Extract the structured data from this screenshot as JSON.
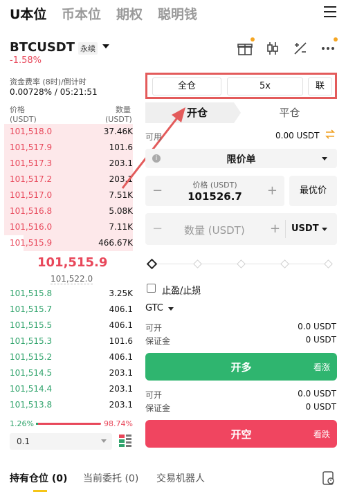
{
  "topnav": {
    "tabs": [
      "U本位",
      "币本位",
      "期权",
      "聪明钱"
    ],
    "active_index": 0
  },
  "pair": {
    "symbol": "BTCUSDT",
    "tag": "永续",
    "change": "-1.58%"
  },
  "icons": {
    "gift": "gift-icon",
    "candles": "candlestick-icon",
    "calc": "calculator-icon",
    "more": "more-icon"
  },
  "funding": {
    "label": "资金费率 (8时)/倒计时",
    "value": "0.00728% / 05:21:51"
  },
  "orderbook": {
    "price_header": "价格",
    "price_unit": "(USDT)",
    "qty_header": "数量",
    "qty_unit": "(USDT)",
    "asks": [
      {
        "price": "101,518.0",
        "qty": "37.46K",
        "depth": 1.0
      },
      {
        "price": "101,517.9",
        "qty": "101.6",
        "depth": 1.0
      },
      {
        "price": "101,517.3",
        "qty": "203.1",
        "depth": 1.0
      },
      {
        "price": "101,517.2",
        "qty": "203.1",
        "depth": 1.0
      },
      {
        "price": "101,517.0",
        "qty": "7.51K",
        "depth": 1.0
      },
      {
        "price": "101,516.8",
        "qty": "5.08K",
        "depth": 1.0
      },
      {
        "price": "101,516.0",
        "qty": "7.11K",
        "depth": 1.0
      },
      {
        "price": "101,515.9",
        "qty": "466.67K",
        "depth": 0.85
      }
    ],
    "last_price": "101,515.9",
    "mark_price": "101,522.0",
    "bids": [
      {
        "price": "101,515.8",
        "qty": "3.25K"
      },
      {
        "price": "101,515.7",
        "qty": "406.1"
      },
      {
        "price": "101,515.5",
        "qty": "406.1"
      },
      {
        "price": "101,515.3",
        "qty": "101.6"
      },
      {
        "price": "101,515.2",
        "qty": "406.1"
      },
      {
        "price": "101,514.5",
        "qty": "203.1"
      },
      {
        "price": "101,514.4",
        "qty": "203.1"
      },
      {
        "price": "101,513.8",
        "qty": "203.1"
      }
    ],
    "buy_ratio": "1.26%",
    "sell_ratio": "98.74%",
    "buy_ratio_value": 0.0126,
    "depth_step": "0.1"
  },
  "trade": {
    "margin_mode": "全仓",
    "leverage": "5x",
    "asset_mode": "联",
    "open_tab": "开仓",
    "close_tab": "平仓",
    "available_label": "可用",
    "available_value": "0.00 USDT",
    "order_type": "限价单",
    "price_label": "价格 (USDT)",
    "price_value": "101526.7",
    "best_price_label": "最优价",
    "qty_placeholder": "数量 (USDT)",
    "qty_unit": "USDT",
    "tpsl_label": "止盈/止损",
    "tif": "GTC",
    "long": {
      "can_open_label": "可开",
      "can_open_value": "0.0 USDT",
      "margin_label": "保证金",
      "margin_value": "0 USDT",
      "button": "开多",
      "side": "看涨"
    },
    "short": {
      "can_open_label": "可开",
      "can_open_value": "0.0 USDT",
      "margin_label": "保证金",
      "margin_value": "0 USDT",
      "button": "开空",
      "side": "看跌"
    }
  },
  "bottom_tabs": {
    "positions": "持有仓位 (0)",
    "orders": "当前委托 (0)",
    "bots": "交易机器人"
  },
  "colors": {
    "ask": "#e8475a",
    "bid": "#2fa36b",
    "long": "#2fb56f",
    "short": "#f04560",
    "highlight": "#e35b5b"
  }
}
